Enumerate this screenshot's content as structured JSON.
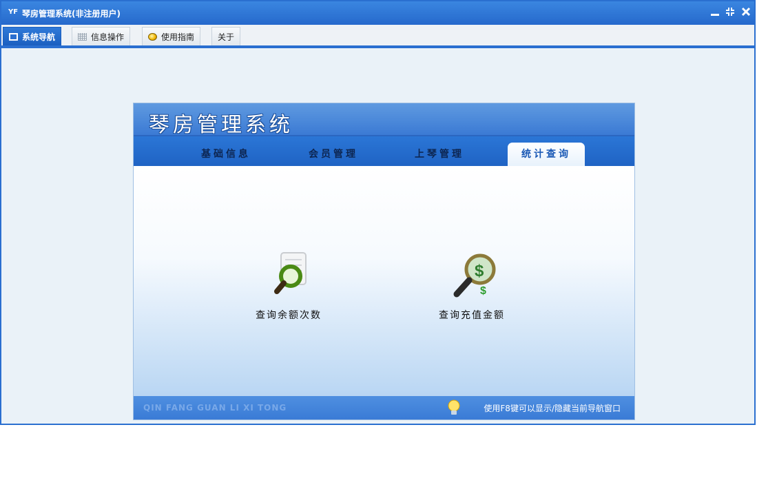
{
  "window": {
    "title": "琴房管理系统(非注册用户)",
    "app_icon": "YF",
    "controls": [
      "minimize-icon",
      "restore-icon",
      "close-icon"
    ]
  },
  "menu": {
    "items": [
      {
        "label": "系统导航",
        "icon": "monitor-icon",
        "active": true
      },
      {
        "label": "信息操作",
        "icon": "grid-icon",
        "active": false
      },
      {
        "label": "使用指南",
        "icon": "help-circle-icon",
        "active": false
      },
      {
        "label": "关于",
        "icon": null,
        "active": false
      }
    ]
  },
  "panel": {
    "title": "琴房管理系统",
    "tabs": [
      {
        "label": "基础信息",
        "active": false
      },
      {
        "label": "会员管理",
        "active": false
      },
      {
        "label": "上琴管理",
        "active": false
      },
      {
        "label": "统计查询",
        "active": true
      }
    ],
    "shortcuts": [
      {
        "label": "查询余额次数",
        "icon": "document-magnifier-icon"
      },
      {
        "label": "查询充值金额",
        "icon": "money-magnifier-icon"
      }
    ],
    "footer": {
      "brand": "QIN FANG GUAN LI XI TONG",
      "tip": "使用F8键可以显示/隐藏当前导航窗口"
    }
  },
  "colors": {
    "accent": "#2a6fd0",
    "panel_header": "#3b7ad4",
    "footer": "#3a7bd6"
  }
}
